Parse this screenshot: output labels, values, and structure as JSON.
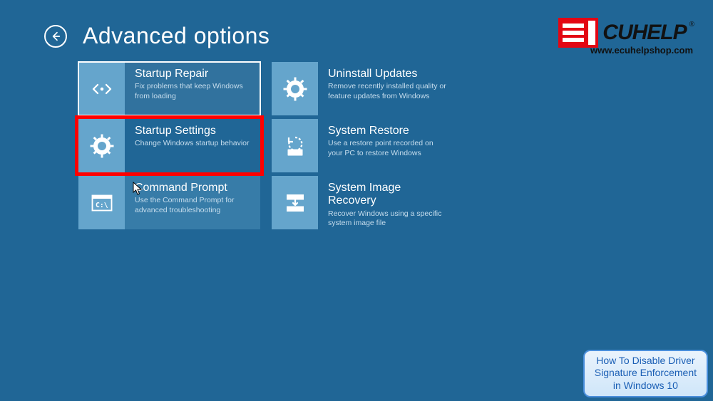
{
  "header": {
    "title": "Advanced options"
  },
  "options": {
    "startup_repair": {
      "title": "Startup Repair",
      "desc": "Fix problems that keep Windows from loading"
    },
    "uninstall_updates": {
      "title": "Uninstall Updates",
      "desc": "Remove recently installed quality or feature updates from Windows"
    },
    "startup_settings": {
      "title": "Startup Settings",
      "desc": "Change Windows startup behavior"
    },
    "system_restore": {
      "title": "System Restore",
      "desc": "Use a restore point recorded on your PC to restore Windows"
    },
    "command_prompt": {
      "title": "Command Prompt",
      "desc": "Use the Command Prompt for advanced troubleshooting"
    },
    "system_image_recovery": {
      "title": "System Image Recovery",
      "desc": "Recover Windows using a specific system image file"
    }
  },
  "watermark": {
    "brand": "CUHELP",
    "url": "www.ecuhelpshop.com"
  },
  "caption": {
    "line1": "How To Disable Driver",
    "line2": "Signature Enforcement",
    "line3": "in Windows 10"
  }
}
